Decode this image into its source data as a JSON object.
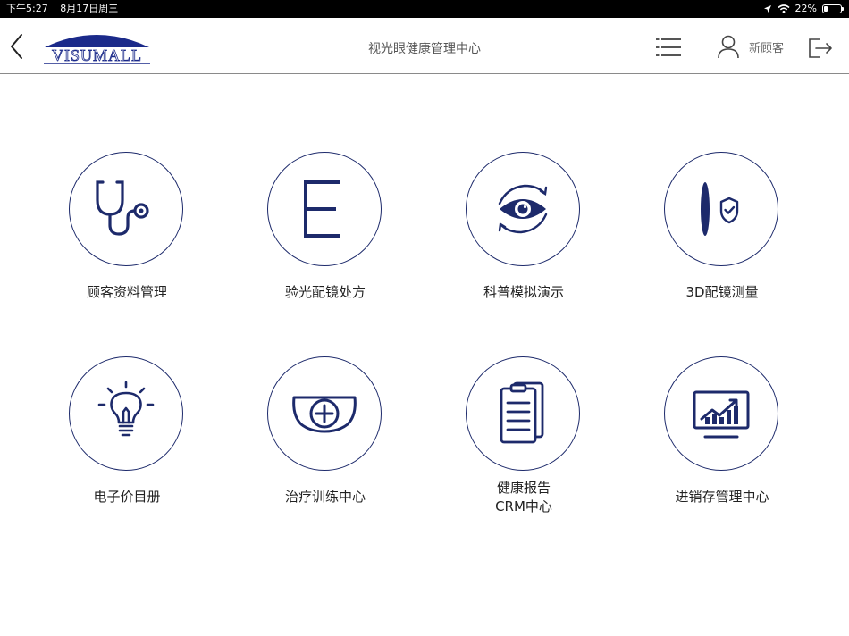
{
  "status_bar": {
    "time": "下午5:27",
    "date": "8月17日周三",
    "battery": "22%",
    "battery_level": 0.22
  },
  "header": {
    "logo_text": "VISUMALL",
    "title": "视光眼健康管理中心",
    "user_label": "新顾客"
  },
  "tiles": [
    {
      "label": "顾客资料管理",
      "icon": "stethoscope-icon"
    },
    {
      "label": "验光配镜处方",
      "icon": "letter-e-chart-icon"
    },
    {
      "label": "科普模拟演示",
      "icon": "rotating-eye-icon"
    },
    {
      "label": "3D配镜测量",
      "icon": "lens-shield-icon"
    },
    {
      "label": "电子价目册",
      "icon": "lightbulb-icon"
    },
    {
      "label": "治疗训练中心",
      "icon": "glasses-plus-icon"
    },
    {
      "label": "健康报告",
      "label_line2": "CRM中心",
      "icon": "clipboard-report-icon"
    },
    {
      "label": "进销存管理中心",
      "icon": "monitor-chart-icon"
    }
  ],
  "colors": {
    "icon_navy": "#1d2a6b",
    "logo_blue": "#1b2a8a"
  }
}
